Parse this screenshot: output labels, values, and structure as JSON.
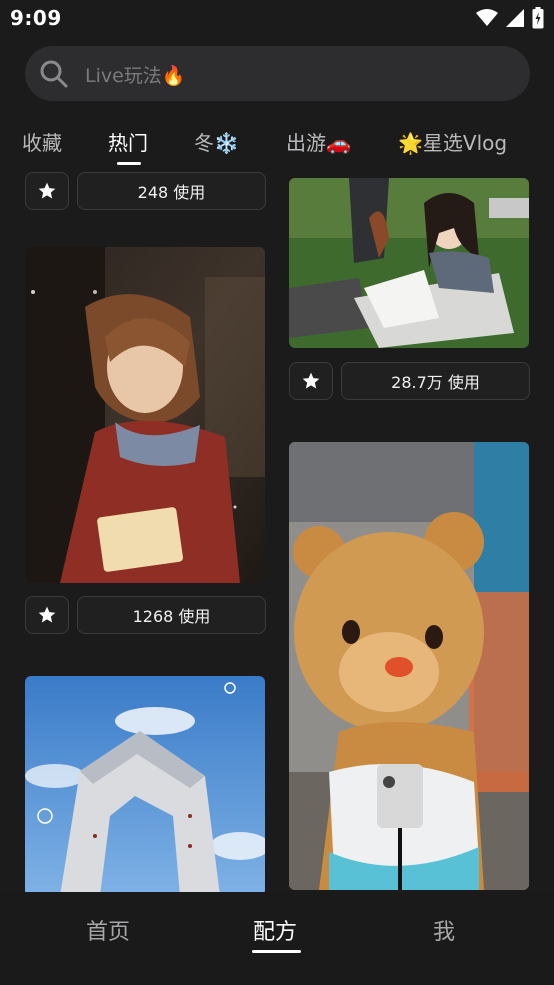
{
  "status": {
    "time": "9:09"
  },
  "search": {
    "placeholder": "Live玩法🔥"
  },
  "tabs": [
    {
      "label": "收藏"
    },
    {
      "label": "热门"
    },
    {
      "label": "冬❄️"
    },
    {
      "label": "出游🚗"
    },
    {
      "label": "🌟星选Vlog"
    }
  ],
  "cards": {
    "left_top_uses": "248 使用",
    "left_middle_uses": "1268 使用",
    "right_top_uses": "28.7万 使用"
  },
  "bottom_nav": [
    {
      "label": "首页"
    },
    {
      "label": "配方"
    },
    {
      "label": "我"
    }
  ],
  "colors": {
    "background": "#1b1b1c",
    "accent": "#ffffff"
  }
}
